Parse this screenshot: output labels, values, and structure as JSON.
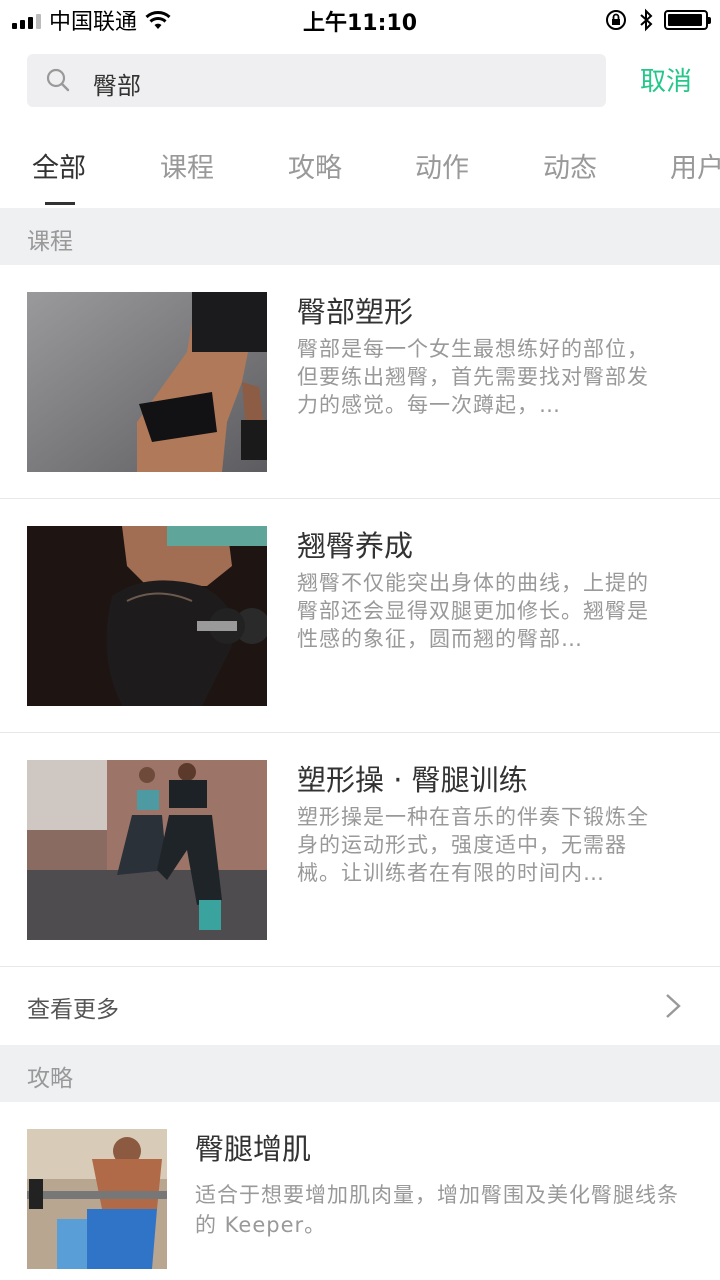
{
  "status_bar": {
    "carrier": "中国联通",
    "time": "上午11:10"
  },
  "search": {
    "query": "臀部",
    "cancel_label": "取消"
  },
  "tabs": [
    {
      "label": "全部",
      "active": true
    },
    {
      "label": "课程",
      "active": false
    },
    {
      "label": "攻略",
      "active": false
    },
    {
      "label": "动作",
      "active": false
    },
    {
      "label": "动态",
      "active": false
    },
    {
      "label": "用户",
      "active": false
    }
  ],
  "courses_section": {
    "header": "课程",
    "items": [
      {
        "title": "臀部塑形",
        "desc": "臀部是每一个女生最想练好的部位，但要练出翘臀，首先需要找对臀部发力的感觉。每一次蹲起，…"
      },
      {
        "title": "翘臀养成",
        "desc": "翘臀不仅能突出身体的曲线，上提的臀部还会显得双腿更加修长。翘臀是性感的象征，圆而翘的臀部…"
      },
      {
        "title": "塑形操 · 臀腿训练",
        "desc": "塑形操是一种在音乐的伴奏下锻炼全身的运动形式，强度适中，无需器械。让训练者在有限的时间内…"
      }
    ],
    "more_label": "查看更多"
  },
  "guides_section": {
    "header": "攻略",
    "items": [
      {
        "title": "臀腿增肌",
        "desc": "适合于想要增加肌肉量，增加臀围及美化臀腿线条的 Keeper。"
      }
    ]
  },
  "colors": {
    "accent": "#24c789",
    "section_bg": "#eef0f2",
    "search_bg": "#efeff1"
  }
}
